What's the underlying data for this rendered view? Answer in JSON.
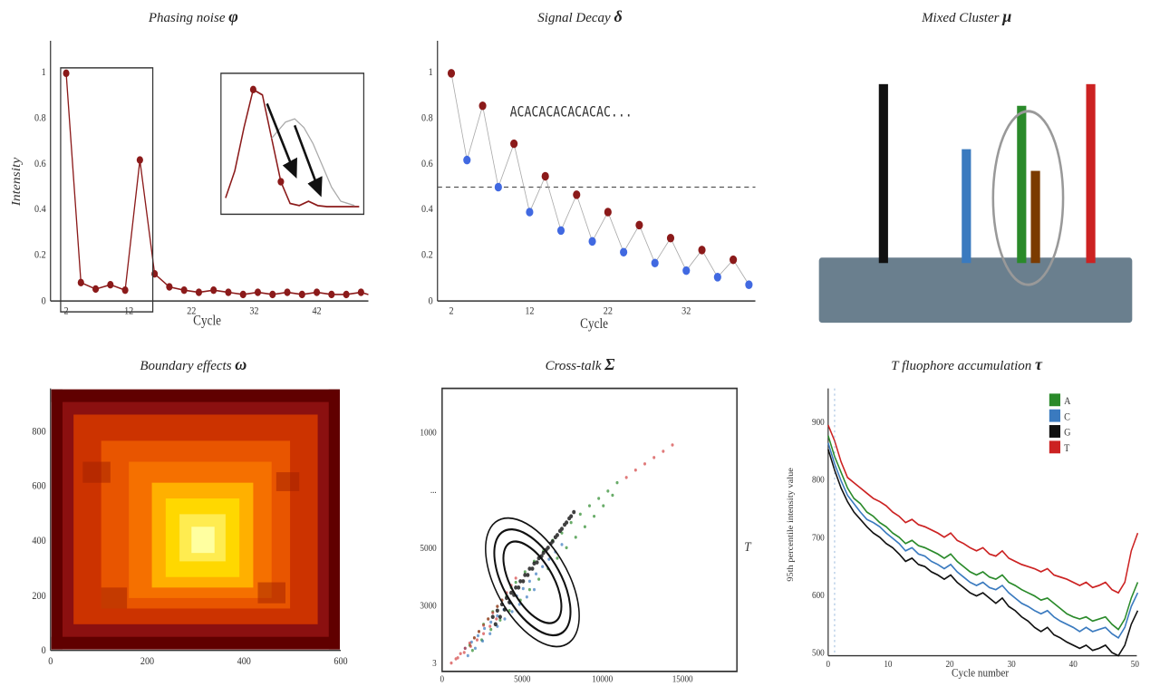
{
  "panels": [
    {
      "id": "phasing-noise",
      "title": "Phasing noise",
      "greek": "φ",
      "position": "top-left"
    },
    {
      "id": "signal-decay",
      "title": "Signal Decay",
      "greek": "δ",
      "position": "top-center"
    },
    {
      "id": "mixed-cluster",
      "title": "Mixed Cluster",
      "greek": "μ",
      "position": "top-right"
    },
    {
      "id": "boundary-effects",
      "title": "Boundary effects",
      "greek": "ω",
      "position": "bottom-left"
    },
    {
      "id": "cross-talk",
      "title": "Cross-talk",
      "greek": "Σ",
      "position": "bottom-center"
    },
    {
      "id": "t-fluophore",
      "title": "T fluophore accumulation",
      "greek": "τ",
      "position": "bottom-right"
    }
  ]
}
